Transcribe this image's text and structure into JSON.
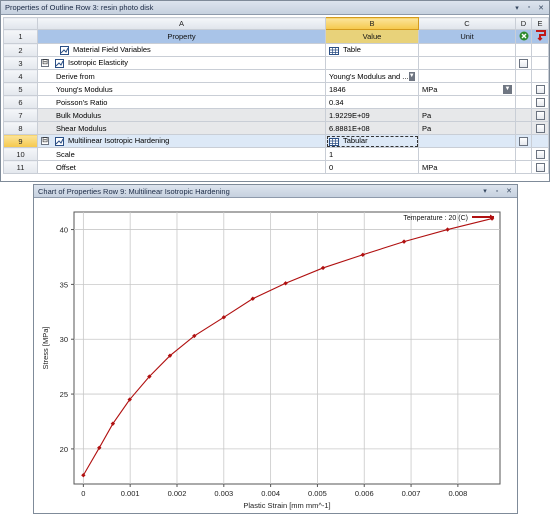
{
  "props_panel": {
    "title": "Properties of Outline Row 3: resin photo disk",
    "window_buttons": [
      "▾",
      "▫",
      "✕"
    ]
  },
  "table": {
    "col_letters": [
      "A",
      "B",
      "C",
      "D",
      "E"
    ],
    "header": {
      "row": "1",
      "property": "Property",
      "value": "Value",
      "unit": "Unit"
    },
    "rows": [
      {
        "n": "2",
        "property": "Material Field Variables",
        "value": "Table",
        "unit": ""
      },
      {
        "n": "3",
        "property": "Isotropic Elasticity",
        "value": "",
        "unit": ""
      },
      {
        "n": "4",
        "property": "Derive from",
        "value": "Young's Modulus and ...",
        "unit": ""
      },
      {
        "n": "5",
        "property": "Young's Modulus",
        "value": "1846",
        "unit": "MPa"
      },
      {
        "n": "6",
        "property": "Poisson's Ratio",
        "value": "0.34",
        "unit": ""
      },
      {
        "n": "7",
        "property": "Bulk Modulus",
        "value": "1.9229E+09",
        "unit": "Pa"
      },
      {
        "n": "8",
        "property": "Shear Modulus",
        "value": "6.8881E+08",
        "unit": "Pa"
      },
      {
        "n": "9",
        "property": "Multilinear Isotropic Hardening",
        "value": "Tabular",
        "unit": ""
      },
      {
        "n": "10",
        "property": "Scale",
        "value": "1",
        "unit": ""
      },
      {
        "n": "11",
        "property": "Offset",
        "value": "0",
        "unit": "MPa"
      }
    ],
    "expand_symbol": "⊟"
  },
  "chart_panel": {
    "title": "Chart of Properties Row 9: Multilinear Isotropic Hardening",
    "window_buttons": [
      "▾",
      "▫",
      "✕"
    ]
  },
  "chart_data": {
    "type": "line",
    "xlabel": "Plastic Strain  [mm mm^-1]",
    "ylabel": "Stress  [MPa]",
    "xlim": [
      -0.0002,
      0.0089
    ],
    "ylim": [
      16.8,
      41.6
    ],
    "xticks": [
      0,
      0.001,
      0.002,
      0.003,
      0.004,
      0.005,
      0.006,
      0.007,
      0.008
    ],
    "xtick_labels": [
      "0",
      "0.001",
      "0.002",
      "0.003",
      "0.004",
      "0.005",
      "0.006",
      "0.007",
      "0.008"
    ],
    "yticks": [
      20,
      25,
      30,
      35,
      40
    ],
    "ytick_labels": [
      "20",
      "25",
      "30",
      "35",
      "40"
    ],
    "grid": true,
    "legend_position": "top-right",
    "series": [
      {
        "name": "Temperature : 20 (C)",
        "color": "#b01010",
        "x": [
          0,
          0.00034,
          0.00063,
          0.00099,
          0.00141,
          0.00185,
          0.00237,
          0.003,
          0.00362,
          0.00432,
          0.00512,
          0.00597,
          0.00685,
          0.00778,
          0.00873
        ],
        "y": [
          17.6,
          20.1,
          22.3,
          24.5,
          26.6,
          28.5,
          30.3,
          32.0,
          33.7,
          35.1,
          36.5,
          37.7,
          38.9,
          40.0,
          41.0
        ]
      }
    ]
  }
}
